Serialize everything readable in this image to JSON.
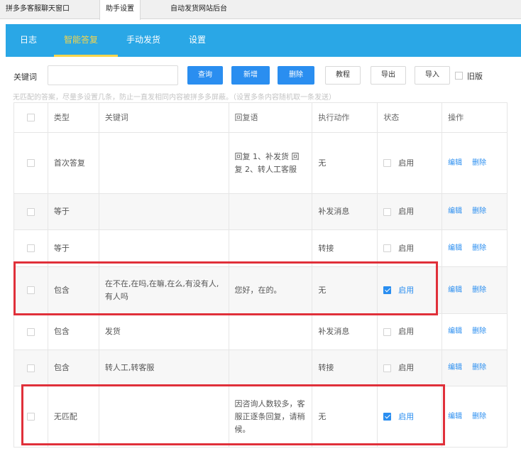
{
  "window_tabs": [
    "拼多多客服聊天窗口",
    "助手设置",
    "自动发货网站后台"
  ],
  "nav": {
    "items": [
      "日志",
      "智能答复",
      "手动发货",
      "设置"
    ],
    "active_index": 1
  },
  "toolbar": {
    "keyword_label": "关键词",
    "keyword_value": "",
    "search_label": "查询",
    "add_label": "新增",
    "delete_label": "删除",
    "tutorial_label": "教程",
    "export_label": "导出",
    "import_label": "导入",
    "legacy_label": "旧版"
  },
  "hint": "无匹配的答案，尽量多设置几条，防止一直发相同内容被拼多多屏蔽。（设置多条内容随机取一条发送）",
  "table": {
    "headers": [
      "类型",
      "关键词",
      "回复语",
      "执行动作",
      "状态",
      "操作"
    ],
    "edit_label": "编辑",
    "delete_label": "删除",
    "rows": [
      {
        "type": "首次答复",
        "keyword": "",
        "reply": "回复 1、补发货 回复 2、转人工客服",
        "action": "无",
        "status_checked": false,
        "status_label": "启用"
      },
      {
        "type": "等于",
        "keyword": "",
        "reply": "",
        "action": "补发消息",
        "status_checked": false,
        "status_label": "启用"
      },
      {
        "type": "等于",
        "keyword": "",
        "reply": "",
        "action": "转接",
        "status_checked": false,
        "status_label": "启用"
      },
      {
        "type": "包含",
        "keyword": "在不在,在吗,在嘛,在么,有没有人,有人吗",
        "reply": "您好，在的。",
        "action": "无",
        "status_checked": true,
        "status_label": "启用"
      },
      {
        "type": "包含",
        "keyword": "发货",
        "reply": "",
        "action": "补发消息",
        "status_checked": false,
        "status_label": "启用"
      },
      {
        "type": "包含",
        "keyword": "转人工,转客服",
        "reply": "",
        "action": "转接",
        "status_checked": false,
        "status_label": "启用"
      },
      {
        "type": "无匹配",
        "keyword": "",
        "reply": "因咨询人数较多，客服正逐条回复，请稍候。",
        "action": "无",
        "status_checked": true,
        "status_label": "启用"
      }
    ]
  },
  "colors": {
    "nav_bg": "#2aa7e6",
    "nav_active": "#f5d54b",
    "primary": "#2a8ef0",
    "highlight": "#e0303a"
  }
}
